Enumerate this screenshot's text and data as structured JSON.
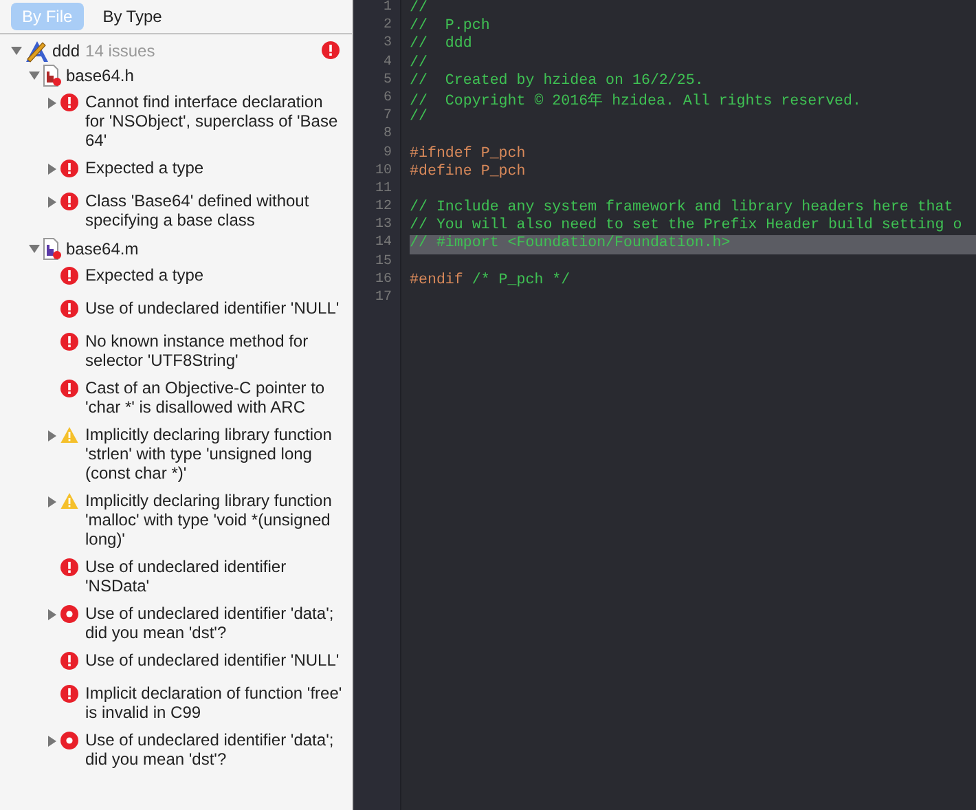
{
  "navigator": {
    "tabs": [
      {
        "label": "By File",
        "selected": true
      },
      {
        "label": "By Type",
        "selected": false
      }
    ],
    "tree": [
      {
        "kind": "project",
        "name": "ddd",
        "count": "14 issues",
        "expanded": true,
        "has_errors": true,
        "children": [
          {
            "kind": "header_file",
            "name": "base64.h",
            "expanded": true,
            "children": [
              {
                "kind": "error",
                "expanded": false,
                "text": "Cannot find interface declaration for 'NSObject', superclass of 'Base 64'"
              },
              {
                "kind": "error",
                "expanded": false,
                "text": "Expected a type"
              },
              {
                "kind": "error",
                "expanded": false,
                "text": "Class 'Base64' defined without specifying a base class"
              }
            ]
          },
          {
            "kind": "implementation_file",
            "name": "base64.m",
            "expanded": true,
            "children": [
              {
                "kind": "error",
                "text": "Expected a type"
              },
              {
                "kind": "error",
                "text": "Use of undeclared identifier 'NULL'"
              },
              {
                "kind": "error",
                "text": "No known instance method for selector 'UTF8String'"
              },
              {
                "kind": "error",
                "text": "Cast of an Objective-C pointer to 'char *' is disallowed with ARC"
              },
              {
                "kind": "warning",
                "expanded": false,
                "text": "Implicitly declaring library function 'strlen' with type 'unsigned long (const char *)'"
              },
              {
                "kind": "warning",
                "expanded": false,
                "text": "Implicitly declaring library function 'malloc' with type 'void *(unsigned long)'"
              },
              {
                "kind": "error",
                "text": "Use of undeclared identifier 'NSData'"
              },
              {
                "kind": "fixit",
                "expanded": false,
                "text": "Use of undeclared identifier 'data'; did you mean 'dst'?"
              },
              {
                "kind": "error",
                "text": "Use of undeclared identifier 'NULL'"
              },
              {
                "kind": "error",
                "text": "Implicit declaration of function 'free' is invalid in C99"
              },
              {
                "kind": "fixit",
                "expanded": false,
                "text": "Use of undeclared identifier 'data'; did you mean 'dst'?"
              }
            ]
          }
        ]
      }
    ]
  },
  "editor": {
    "lines": [
      {
        "number": "1",
        "highlighted": false,
        "segments": [
          {
            "kind": "comment",
            "text": "//"
          }
        ]
      },
      {
        "number": "2",
        "highlighted": false,
        "segments": [
          {
            "kind": "comment",
            "text": "//  P.pch"
          }
        ]
      },
      {
        "number": "3",
        "highlighted": false,
        "segments": [
          {
            "kind": "comment",
            "text": "//  ddd"
          }
        ]
      },
      {
        "number": "4",
        "highlighted": false,
        "segments": [
          {
            "kind": "comment",
            "text": "//"
          }
        ]
      },
      {
        "number": "5",
        "highlighted": false,
        "segments": [
          {
            "kind": "comment",
            "text": "//  Created by hzidea on 16/2/25."
          }
        ]
      },
      {
        "number": "6",
        "highlighted": false,
        "segments": [
          {
            "kind": "comment",
            "text": "//  Copyright © 2016年 hzidea. All rights reserved."
          }
        ]
      },
      {
        "number": "7",
        "highlighted": false,
        "segments": [
          {
            "kind": "comment",
            "text": "//"
          }
        ]
      },
      {
        "number": "8",
        "highlighted": false
      },
      {
        "number": "9",
        "highlighted": false,
        "segments": [
          {
            "kind": "directive",
            "text": "#ifndef P_pch"
          }
        ]
      },
      {
        "number": "10",
        "highlighted": false,
        "segments": [
          {
            "kind": "directive",
            "text": "#define P_pch"
          }
        ]
      },
      {
        "number": "11",
        "highlighted": false
      },
      {
        "number": "12",
        "highlighted": false,
        "segments": [
          {
            "kind": "comment",
            "text": "// Include any system framework and library headers here that"
          }
        ]
      },
      {
        "number": "13",
        "highlighted": false,
        "segments": [
          {
            "kind": "comment",
            "text": "// You will also need to set the Prefix Header build setting o"
          }
        ]
      },
      {
        "number": "14",
        "highlighted": true,
        "segments": [
          {
            "kind": "comment",
            "text": "// #import <Foundation/Foundation.h>"
          }
        ]
      },
      {
        "number": "15",
        "highlighted": false
      },
      {
        "number": "16",
        "highlighted": false,
        "segments": [
          {
            "kind": "directive",
            "text": "#endif "
          },
          {
            "kind": "comment",
            "text": "/* P_pch */"
          }
        ]
      },
      {
        "number": "17",
        "highlighted": false
      }
    ]
  }
}
